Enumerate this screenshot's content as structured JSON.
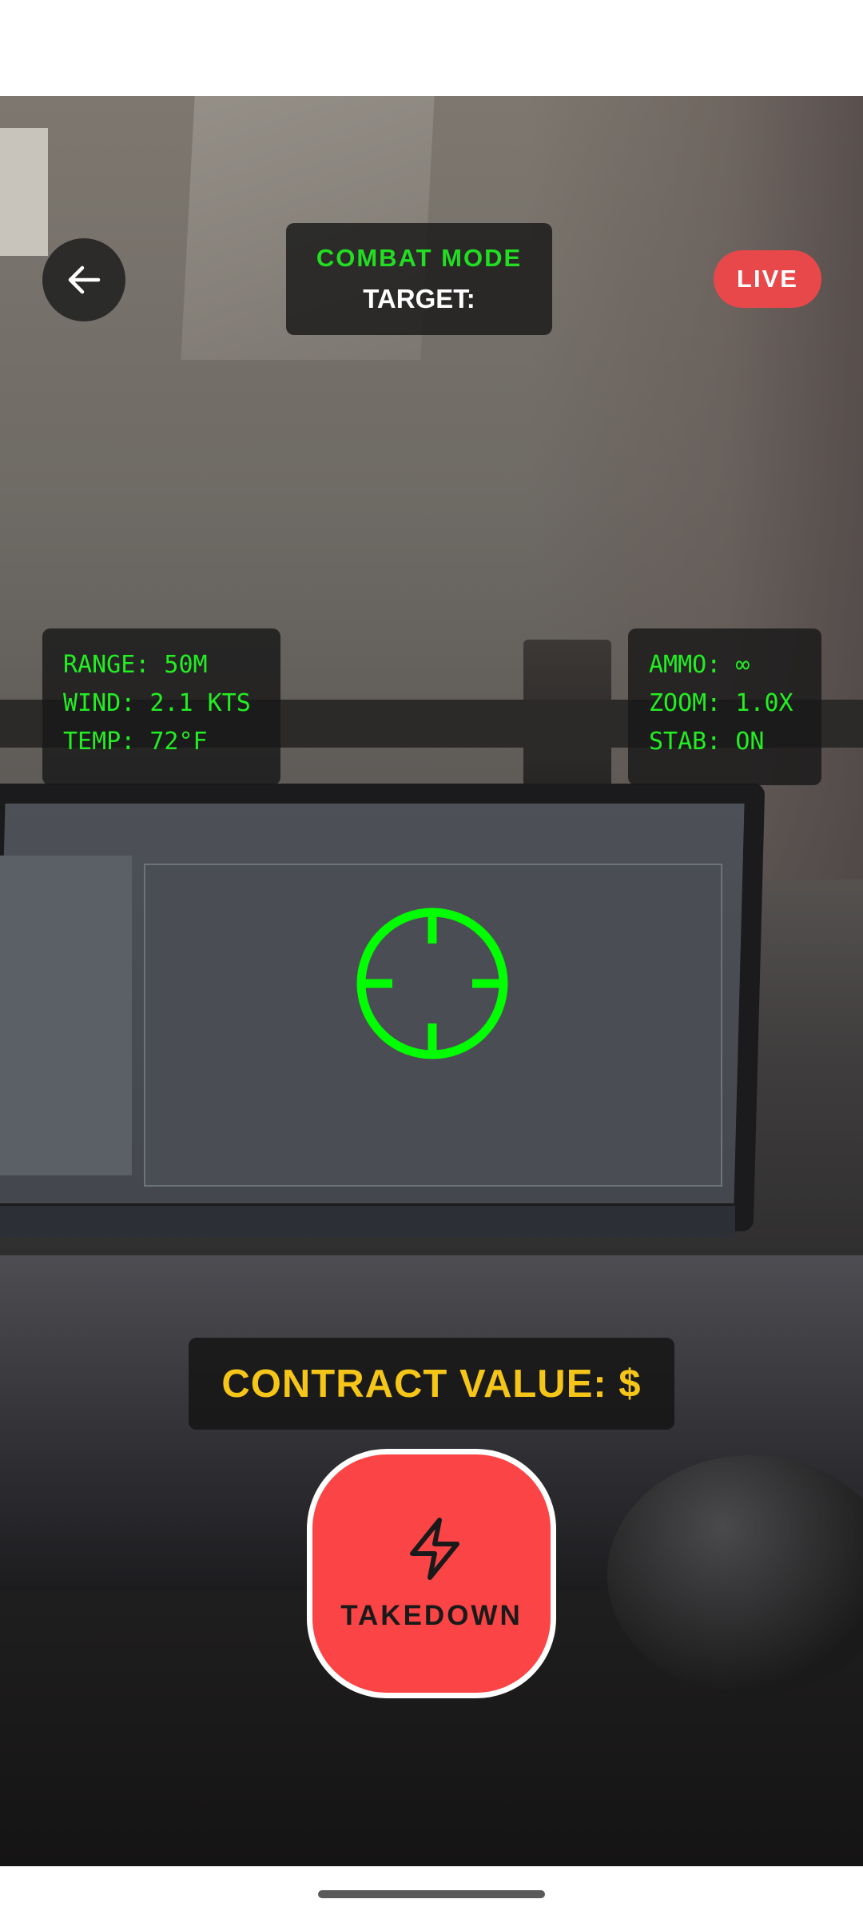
{
  "header": {
    "back_icon": "arrow-left-icon",
    "mode_title": "COMBAT MODE",
    "target_label": "TARGET:",
    "live_badge": "LIVE"
  },
  "hud_left": {
    "range": "RANGE: 50M",
    "wind": "WIND: 2.1 KTS",
    "temp": "TEMP: 72°F"
  },
  "hud_right": {
    "ammo": "AMMO: ∞",
    "zoom": "ZOOM: 1.0X",
    "stab": "STAB: ON"
  },
  "reticle": {
    "icon": "crosshair-icon",
    "color": "#00ff00"
  },
  "contract": {
    "label": "CONTRACT VALUE: $"
  },
  "action": {
    "label": "TAKEDOWN",
    "icon": "lightning-bolt-icon"
  },
  "colors": {
    "hud_green": "#22ee22",
    "live_red": "#e9484a",
    "takedown_red": "#fb4445",
    "contract_yellow": "#f5c518"
  }
}
